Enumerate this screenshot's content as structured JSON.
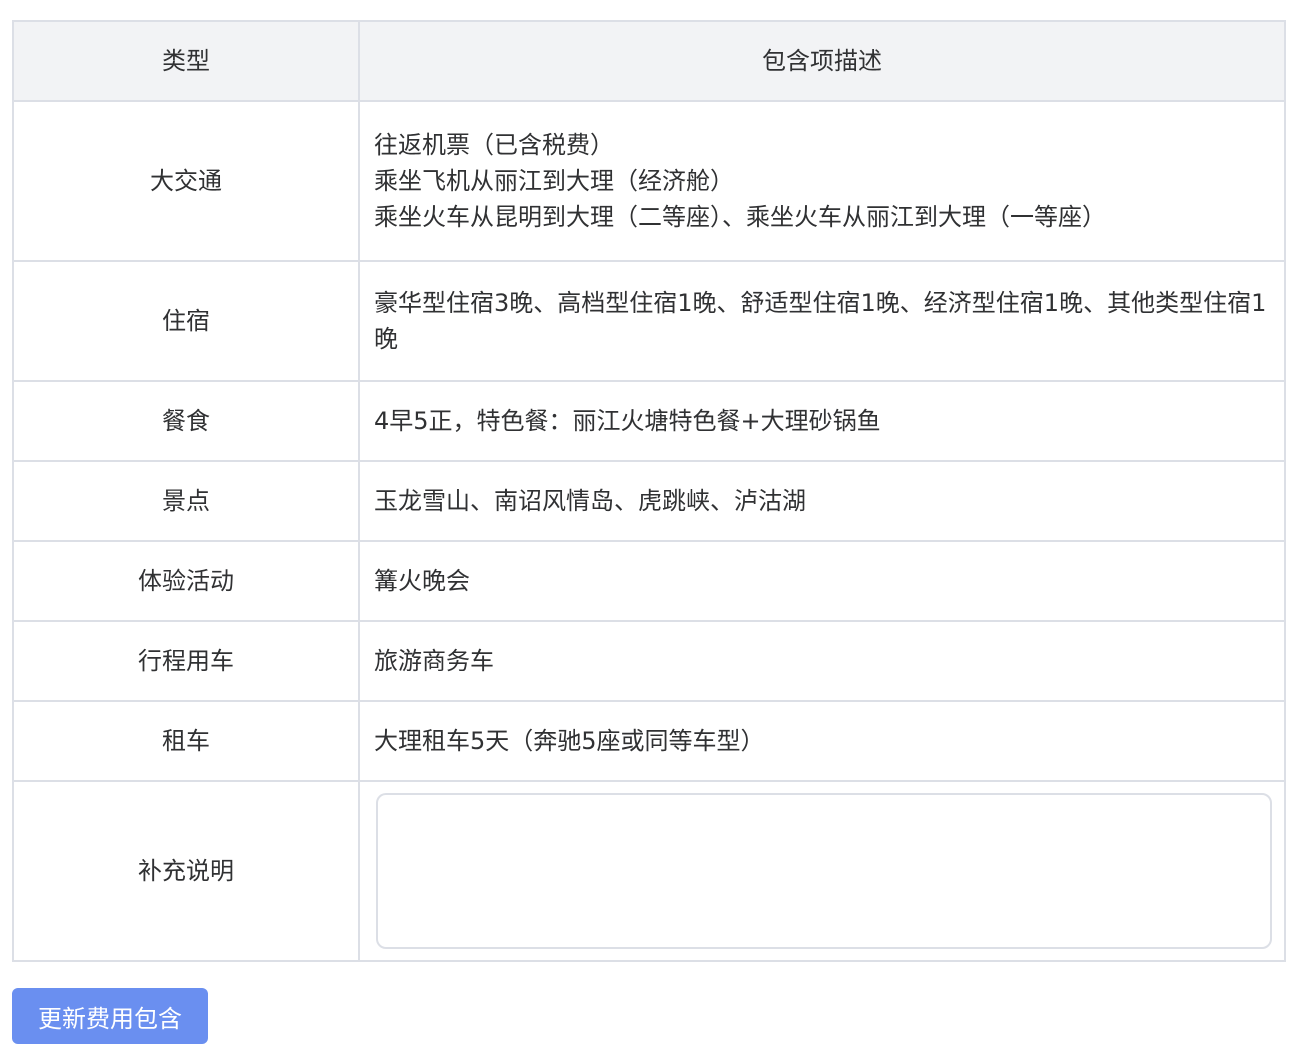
{
  "table": {
    "headers": [
      "类型",
      "包含项描述"
    ],
    "rows": [
      {
        "type": "大交通",
        "lines": [
          "往返机票（已含税费）",
          "乘坐飞机从丽江到大理（经济舱）",
          "乘坐火车从昆明到大理（二等座）、乘坐火车从丽江到大理（一等座）"
        ]
      },
      {
        "type": "住宿",
        "lines": [
          "豪华型住宿3晚、高档型住宿1晚、舒适型住宿1晚、经济型住宿1晚、其他类型住宿1晚"
        ]
      },
      {
        "type": "餐食",
        "lines": [
          "4早5正，特色餐：丽江火塘特色餐+大理砂锅鱼"
        ]
      },
      {
        "type": "景点",
        "lines": [
          "玉龙雪山、南诏风情岛、虎跳峡、泸沽湖"
        ]
      },
      {
        "type": "体验活动",
        "lines": [
          "篝火晚会"
        ]
      },
      {
        "type": "行程用车",
        "lines": [
          "旅游商务车"
        ]
      },
      {
        "type": "租车",
        "lines": [
          "大理租车5天（奔驰5座或同等车型）"
        ]
      }
    ],
    "note": {
      "type": "补充说明",
      "value": ""
    }
  },
  "actions": {
    "update_label": "更新费用包含"
  }
}
